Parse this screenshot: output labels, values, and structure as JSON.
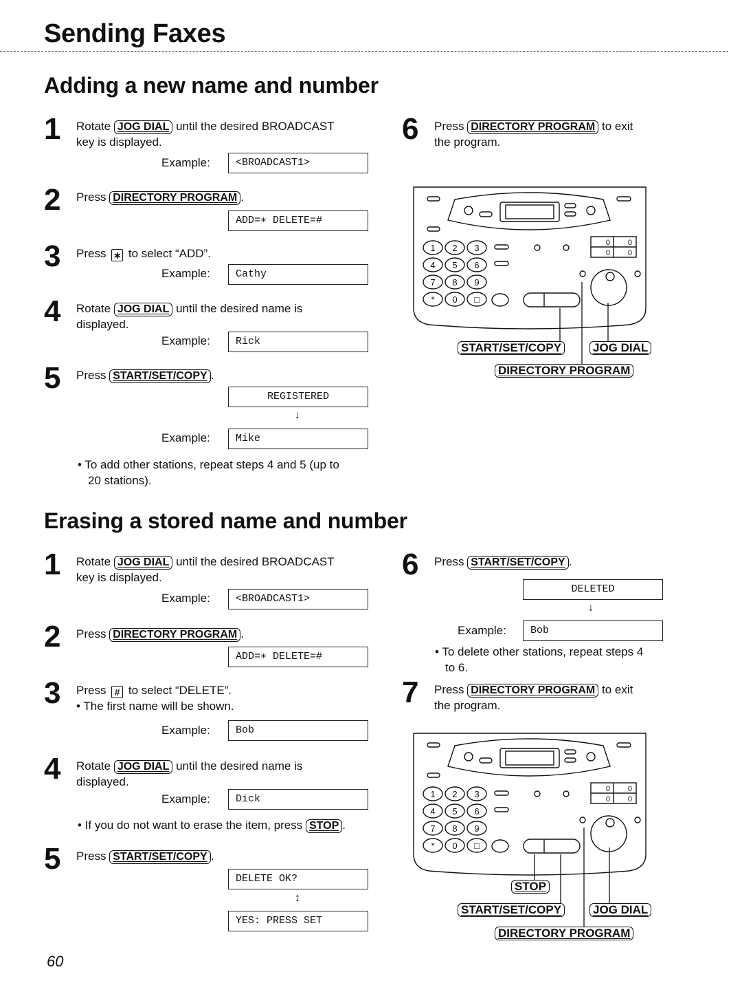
{
  "page": {
    "title": "Sending Faxes",
    "page_number": "60"
  },
  "adding": {
    "title": "Adding a new name and number",
    "steps": [
      {
        "num": "1",
        "pre": "Rotate ",
        "key": "JOG DIAL",
        "post": " until the desired BROADCAST",
        "line2": "key is displayed.",
        "example_label": "Example:",
        "lcd": "<BROADCAST1>"
      },
      {
        "num": "2",
        "pre": "Press ",
        "key": "DIRECTORY PROGRAM",
        "post": ".",
        "lcd": "ADD=∗ DELETE=#"
      },
      {
        "num": "3",
        "pre": "Press ",
        "key": "∗",
        "post": " to select “ADD”.",
        "example_label": "Example:",
        "lcd": "Cathy"
      },
      {
        "num": "4",
        "pre": "Rotate ",
        "key": "JOG DIAL",
        "post": " until the desired name is",
        "line2": "displayed.",
        "example_label": "Example:",
        "lcd": "Rick"
      },
      {
        "num": "5",
        "pre": "Press ",
        "key": "START/SET/COPY",
        "post": ".",
        "lcd": "REGISTERED",
        "arrow": "↓",
        "example_label": "Example:",
        "lcd2": "Mike",
        "note": "• To add other stations, repeat steps 4 and 5 (up to",
        "note2": "20 stations)."
      },
      {
        "num": "6",
        "pre": "Press ",
        "key": "DIRECTORY PROGRAM",
        "post": " to exit",
        "line2": "the program."
      }
    ],
    "diagram": {
      "callouts": [
        "START/SET/COPY",
        "JOG DIAL",
        "DIRECTORY PROGRAM"
      ]
    }
  },
  "erasing": {
    "title": "Erasing a stored name and number",
    "steps": [
      {
        "num": "1",
        "pre": "Rotate ",
        "key": "JOG DIAL",
        "post": " until the desired BROADCAST",
        "line2": "key is displayed.",
        "example_label": "Example:",
        "lcd": "<BROADCAST1>"
      },
      {
        "num": "2",
        "pre": "Press ",
        "key": "DIRECTORY PROGRAM",
        "post": ".",
        "lcd": "ADD=∗ DELETE=#"
      },
      {
        "num": "3",
        "pre": "Press ",
        "key": "#",
        "post": " to select “DELETE”.",
        "line2": "• The first name will be shown.",
        "example_label": "Example:",
        "lcd": "Bob"
      },
      {
        "num": "4",
        "pre": "Rotate ",
        "key": "JOG DIAL",
        "post": " until the desired name is",
        "line2": "displayed.",
        "example_label": "Example:",
        "lcd": "Dick",
        "note_pre": "• If you do not want to erase the item, press ",
        "note_key": "STOP",
        "note_post": "."
      },
      {
        "num": "5",
        "pre": "Press ",
        "key": "START/SET/COPY",
        "post": ".",
        "lcd": "DELETE OK?",
        "arrow": "↕",
        "lcd2": "YES: PRESS SET"
      },
      {
        "num": "6",
        "pre": "Press ",
        "key": "START/SET/COPY",
        "post": ".",
        "lcd": "DELETED",
        "arrow": "↓",
        "example_label": "Example:",
        "lcd2": "Bob",
        "note": "• To delete other stations, repeat steps 4",
        "note2": "to 6."
      },
      {
        "num": "7",
        "pre": "Press ",
        "key": "DIRECTORY PROGRAM",
        "post": " to exit",
        "line2": "the program."
      }
    ],
    "diagram": {
      "callouts": [
        "STOP",
        "START/SET/COPY",
        "JOG DIAL",
        "DIRECTORY PROGRAM"
      ]
    }
  },
  "keypad": [
    "1",
    "2",
    "3",
    "4",
    "5",
    "6",
    "7",
    "8",
    "9",
    "*",
    "0",
    "□"
  ],
  "counter_digits": [
    "0",
    "0",
    "0",
    "0"
  ]
}
